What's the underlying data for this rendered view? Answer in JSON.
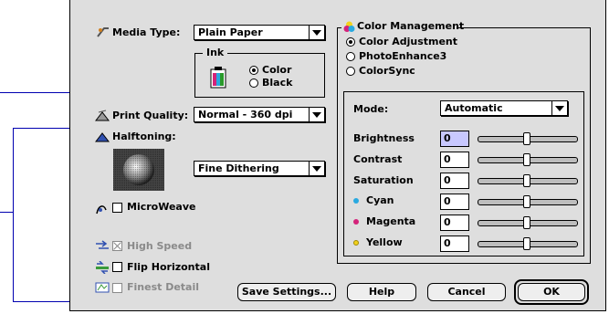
{
  "media": {
    "label": "Media Type:",
    "value": "Plain Paper"
  },
  "ink": {
    "title": "Ink",
    "options": [
      "Color",
      "Black"
    ],
    "selected": "Color"
  },
  "print_quality": {
    "label": "Print Quality:",
    "value": "Normal - 360 dpi"
  },
  "halftoning": {
    "label": "Halftoning:",
    "value": "Fine Dithering"
  },
  "microweave": {
    "label": "MicroWeave",
    "checked": false
  },
  "high_speed": {
    "label": "High Speed",
    "checked": true,
    "enabled": false
  },
  "flip_horizontal": {
    "label": "Flip Horizontal",
    "checked": false
  },
  "finest_detail": {
    "label": "Finest Detail",
    "checked": false,
    "enabled": false
  },
  "color_management": {
    "title": "Color Management",
    "options": [
      "Color Adjustment",
      "PhotoEnhance3",
      "ColorSync"
    ],
    "selected": "Color Adjustment",
    "mode_label": "Mode:",
    "mode_value": "Automatic",
    "sliders": [
      {
        "label": "Brightness",
        "value": "0",
        "dot": ""
      },
      {
        "label": "Contrast",
        "value": "0",
        "dot": ""
      },
      {
        "label": "Saturation",
        "value": "0",
        "dot": ""
      },
      {
        "label": "Cyan",
        "value": "0",
        "dot": "#29a9e0"
      },
      {
        "label": "Magenta",
        "value": "0",
        "dot": "#d4237a"
      },
      {
        "label": "Yellow",
        "value": "0",
        "dot": "#f2d21c"
      }
    ]
  },
  "buttons": {
    "save": "Save Settings...",
    "help": "Help",
    "cancel": "Cancel",
    "ok": "OK"
  },
  "colors": {
    "callout_line": "#0000b0",
    "dialog_bg": "#dedede"
  }
}
